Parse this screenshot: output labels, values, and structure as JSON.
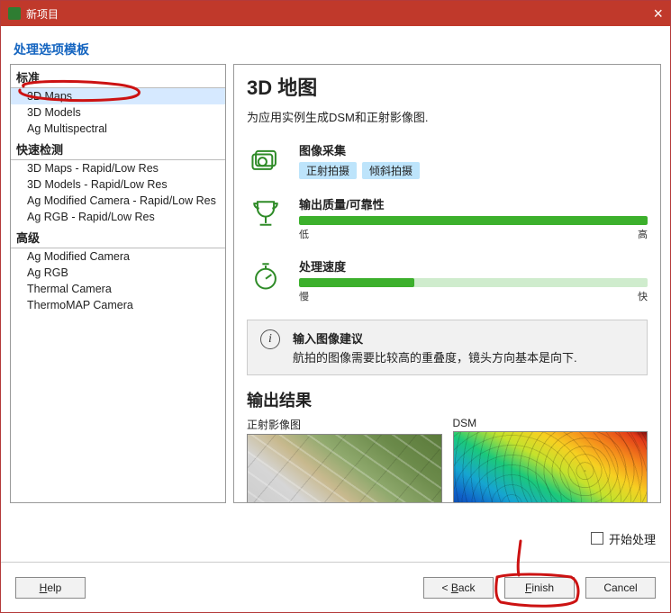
{
  "window": {
    "title": "新项目"
  },
  "subtitle": "处理选项模板",
  "tree": {
    "groups": [
      {
        "header": "标准",
        "items": [
          {
            "label": "3D Maps",
            "selected": true,
            "annotated": true
          },
          {
            "label": "3D Models"
          },
          {
            "label": "Ag Multispectral"
          }
        ]
      },
      {
        "header": "快速检测",
        "items": [
          {
            "label": "3D Maps - Rapid/Low Res"
          },
          {
            "label": "3D Models - Rapid/Low Res"
          },
          {
            "label": "Ag Modified Camera - Rapid/Low Res"
          },
          {
            "label": "Ag RGB - Rapid/Low Res"
          }
        ]
      },
      {
        "header": "高级",
        "items": [
          {
            "label": "Ag Modified Camera"
          },
          {
            "label": "Ag RGB"
          },
          {
            "label": "Thermal Camera"
          },
          {
            "label": "ThermoMAP Camera"
          }
        ]
      }
    ]
  },
  "detail": {
    "title": "3D 地图",
    "description": "为应用实例生成DSM和正射影像图.",
    "capture": {
      "label": "图像采集",
      "tags": [
        "正射拍摄",
        "倾斜拍摄"
      ]
    },
    "quality": {
      "label": "输出质量/可靠性",
      "low": "低",
      "high": "高",
      "value_pct": 100
    },
    "speed": {
      "label": "处理速度",
      "slow": "慢",
      "fast": "快",
      "value_pct": 33
    },
    "info": {
      "title": "输入图像建议",
      "body": "航拍的图像需要比较高的重叠度，镜头方向基本是向下."
    },
    "output": {
      "section": "输出结果",
      "ortho_label": "正射影像图",
      "dsm_label": "DSM"
    }
  },
  "checkbox": {
    "label": "开始处理",
    "checked": false
  },
  "buttons": {
    "help": "Help",
    "back": "< Back",
    "finish": "Finish",
    "cancel": "Cancel"
  },
  "annotation": {
    "circled_template": "3D Maps",
    "circled_button": "Finish",
    "color": "#cc1212"
  }
}
